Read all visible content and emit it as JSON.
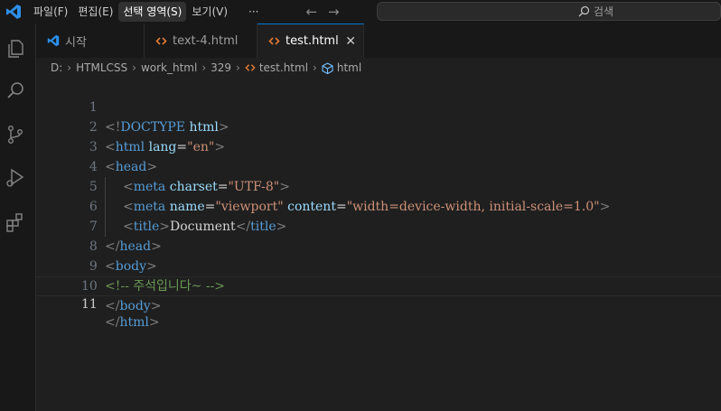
{
  "menu": {
    "items": [
      "파일(F)",
      "편집(E)",
      "선택 영역(S)",
      "보기(V)"
    ],
    "more": "···",
    "active_index": 2
  },
  "search": {
    "text": "검색"
  },
  "tabs": [
    {
      "label": "시작",
      "icon": "vscode-logo-icon"
    },
    {
      "label": "text-4.html",
      "icon": "html-icon"
    },
    {
      "label": "test.html",
      "icon": "html-icon",
      "active": true,
      "close": "✕"
    }
  ],
  "breadcrumb": [
    "D:",
    "HTMLCSS",
    "work_html",
    "329",
    "test.html",
    "html"
  ],
  "editor": {
    "current_line": 11,
    "lines": [
      {
        "n": "1",
        "text": "<!DOCTYPE html>"
      },
      {
        "n": "2",
        "text": "<html lang=\"en\">"
      },
      {
        "n": "3",
        "text": "<head>"
      },
      {
        "n": "4",
        "text": "<meta charset=\"UTF-8\">"
      },
      {
        "n": "5",
        "text": "<meta name=\"viewport\" content=\"width=device-width, initial-scale=1.0\">"
      },
      {
        "n": "6",
        "text": "<title>Document</title>"
      },
      {
        "n": "7",
        "text": "</head>"
      },
      {
        "n": "8",
        "text": "<body>"
      },
      {
        "n": "9",
        "text": "<!-- 주석입니다~ -->"
      },
      {
        "n": "10",
        "text": "</body>"
      },
      {
        "n": "11",
        "text": "</html>"
      }
    ]
  },
  "colors": {
    "accent": "#0078d4",
    "tag": "#569cd6",
    "attribute": "#9cdcfe",
    "string": "#ce9178",
    "comment": "#6a9955",
    "html_icon": "#e37933"
  }
}
